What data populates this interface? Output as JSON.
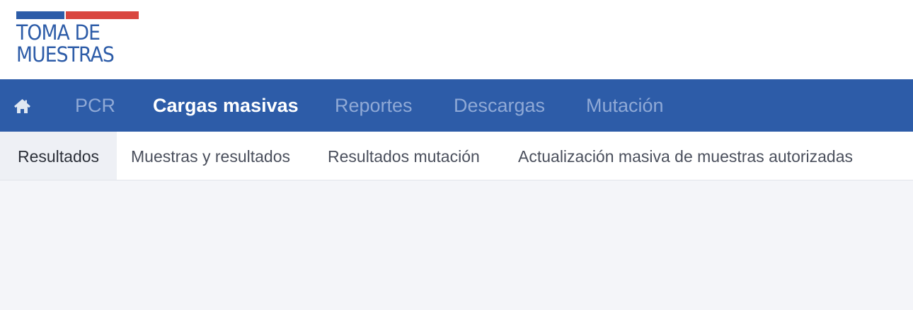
{
  "logo": {
    "line1": "TOMA DE",
    "line2": "MUESTRAS",
    "colors": {
      "blue": "#2d5ca8",
      "red": "#d9463f"
    }
  },
  "navbar": {
    "background": "#2d5ca8",
    "home_icon": "home-icon",
    "items": [
      {
        "label": "PCR",
        "active": false
      },
      {
        "label": "Cargas masivas",
        "active": true
      },
      {
        "label": "Reportes",
        "active": false
      },
      {
        "label": "Descargas",
        "active": false
      },
      {
        "label": "Mutación",
        "active": false
      }
    ]
  },
  "subnav": {
    "items": [
      {
        "label": "Resultados",
        "active": true
      },
      {
        "label": "Muestras y resultados",
        "active": false
      },
      {
        "label": "Resultados mutación",
        "active": false
      },
      {
        "label": "Actualización masiva de muestras autorizadas",
        "active": false
      }
    ]
  }
}
